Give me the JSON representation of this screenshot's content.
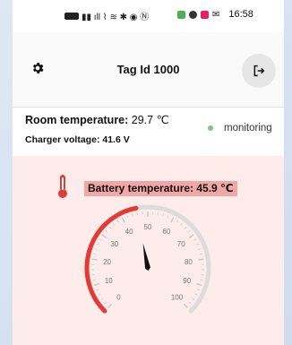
{
  "statusbar": {
    "time": "16:58",
    "signal_text": "▮▮ ıll ⌇ ≋ ✱ ◉ Ⓝ"
  },
  "header": {
    "title": "Tag Id 1000",
    "settings_icon": "gear-icon",
    "logout_icon": "logout-icon"
  },
  "info": {
    "room_label": "Room temperature:",
    "room_value": "29.7 ℃",
    "charger_text": "Charger voltage: 41.6 V",
    "status": "monitoring",
    "status_color": "#7cc97c"
  },
  "battery": {
    "label": "Battery temperature: 45.9 ℃",
    "value": 45.9,
    "icon": "thermometer-icon",
    "accent": "#e53935"
  },
  "gauge": {
    "min": 0,
    "max": 100,
    "ticks": [
      "0",
      "10",
      "20",
      "30",
      "40",
      "50",
      "60",
      "70",
      "80",
      "90",
      "100"
    ],
    "value": 45.9,
    "fill_color": "#e53935",
    "track_color": "#dcdcdc"
  }
}
